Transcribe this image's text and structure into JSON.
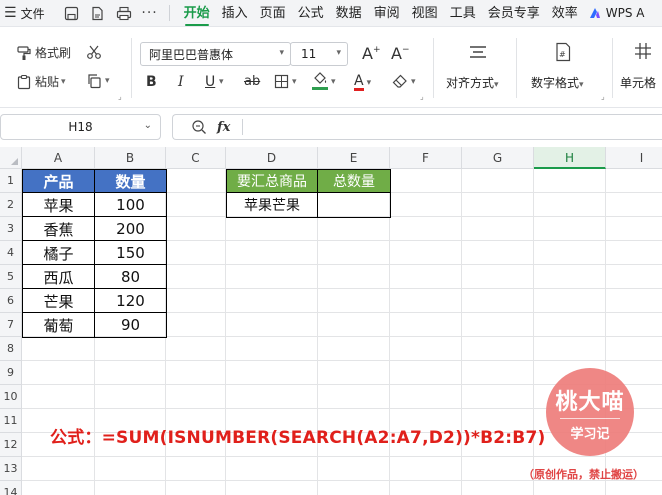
{
  "menubar": {
    "menu_label": "文件",
    "tabs": [
      "开始",
      "插入",
      "页面",
      "公式",
      "数据",
      "审阅",
      "视图",
      "工具",
      "会员专享",
      "效率"
    ],
    "active_tab": "开始",
    "ai_label": "WPS A"
  },
  "ribbon": {
    "format_painter": "格式刷",
    "paste": "粘贴",
    "font_name": "阿里巴巴普惠体",
    "font_size": "11",
    "align_label": "对齐方式",
    "number_format_label": "数字格式",
    "cell_label": "单元格",
    "fill_color": "#2e9e4f"
  },
  "formula_bar": {
    "cell_ref": "H18",
    "fx_label": "fx",
    "formula_value": ""
  },
  "sheet": {
    "columns": [
      "A",
      "B",
      "C",
      "D",
      "E",
      "F",
      "G",
      "H",
      "I"
    ],
    "selected_column": "H",
    "rows": [
      "1",
      "2",
      "3",
      "4",
      "5",
      "6",
      "7",
      "8",
      "9",
      "10",
      "11",
      "12",
      "13",
      "14"
    ],
    "table1": {
      "headers": [
        "产品",
        "数量"
      ],
      "rows": [
        [
          "苹果",
          "100"
        ],
        [
          "香蕉",
          "200"
        ],
        [
          "橘子",
          "150"
        ],
        [
          "西瓜",
          "80"
        ],
        [
          "芒果",
          "120"
        ],
        [
          "葡萄",
          "90"
        ]
      ],
      "header_color": "#4472c4"
    },
    "table2": {
      "headers": [
        "要汇总商品",
        "总数量"
      ],
      "rows": [
        [
          "苹果芒果",
          ""
        ]
      ],
      "header_color": "#70ad47"
    },
    "formula_note": "公式：=SUM(ISNUMBER(SEARCH(A2:A7,D2))*B2:B7)",
    "note_color": "#e0201b"
  },
  "watermark": {
    "title": "桃大喵",
    "subtitle": "学习记",
    "copyright": "（原创作品，禁止搬运）",
    "color": "#ee7d7b"
  }
}
